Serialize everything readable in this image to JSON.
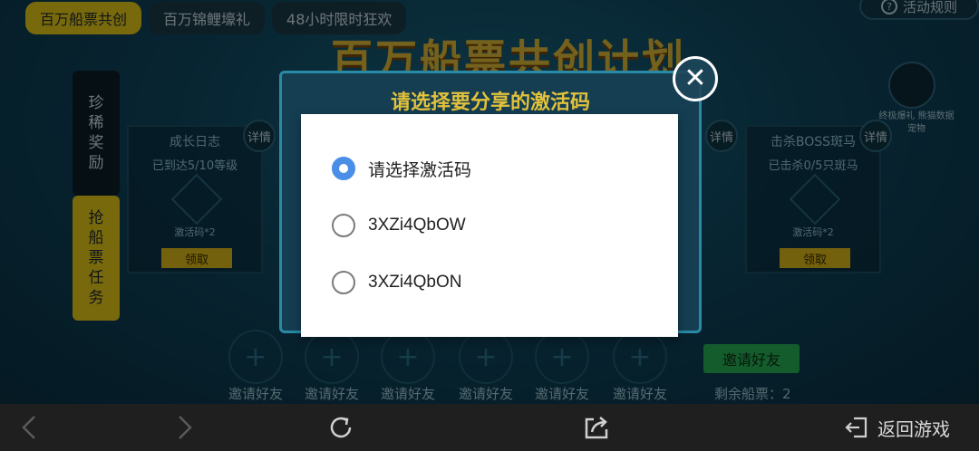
{
  "top_tabs": [
    "百万船票共创",
    "百万锦鲤壕礼",
    "48小时限时狂欢"
  ],
  "rules_button": "活动规则",
  "main_title": "百万船票共创计划",
  "side_tabs": {
    "rare": [
      "珍",
      "稀",
      "奖",
      "励"
    ],
    "task": [
      "抢",
      "船",
      "票",
      "任",
      "务"
    ]
  },
  "cards": [
    {
      "title": "成长日志",
      "status": "已到达5/10等级",
      "reward": "激活码*2",
      "button": "领取"
    },
    {
      "title": "击杀BOSS斑马",
      "status": "已击杀0/5只斑马",
      "reward": "激活码*2",
      "button": "领取"
    }
  ],
  "detail_label": "详情",
  "panda_caption": "终极爆礼 熊猫数据宠物",
  "invite_label": "邀请好友",
  "invite_button": "邀请好友",
  "remaining_tickets": "剩余船票：2",
  "share_dialog": {
    "title": "请选择要分享的激活码"
  },
  "choice_dialog": {
    "options": [
      {
        "label": "请选择激活码",
        "checked": true
      },
      {
        "label": "3XZi4QbOW",
        "checked": false
      },
      {
        "label": "3XZi4QbON",
        "checked": false
      }
    ]
  },
  "bottom_bar": {
    "back_to_game": "返回游戏"
  },
  "colors": {
    "accent_yellow": "#f3d21b",
    "radio_blue": "#4a8ee8",
    "invite_green": "#2ab85a"
  }
}
